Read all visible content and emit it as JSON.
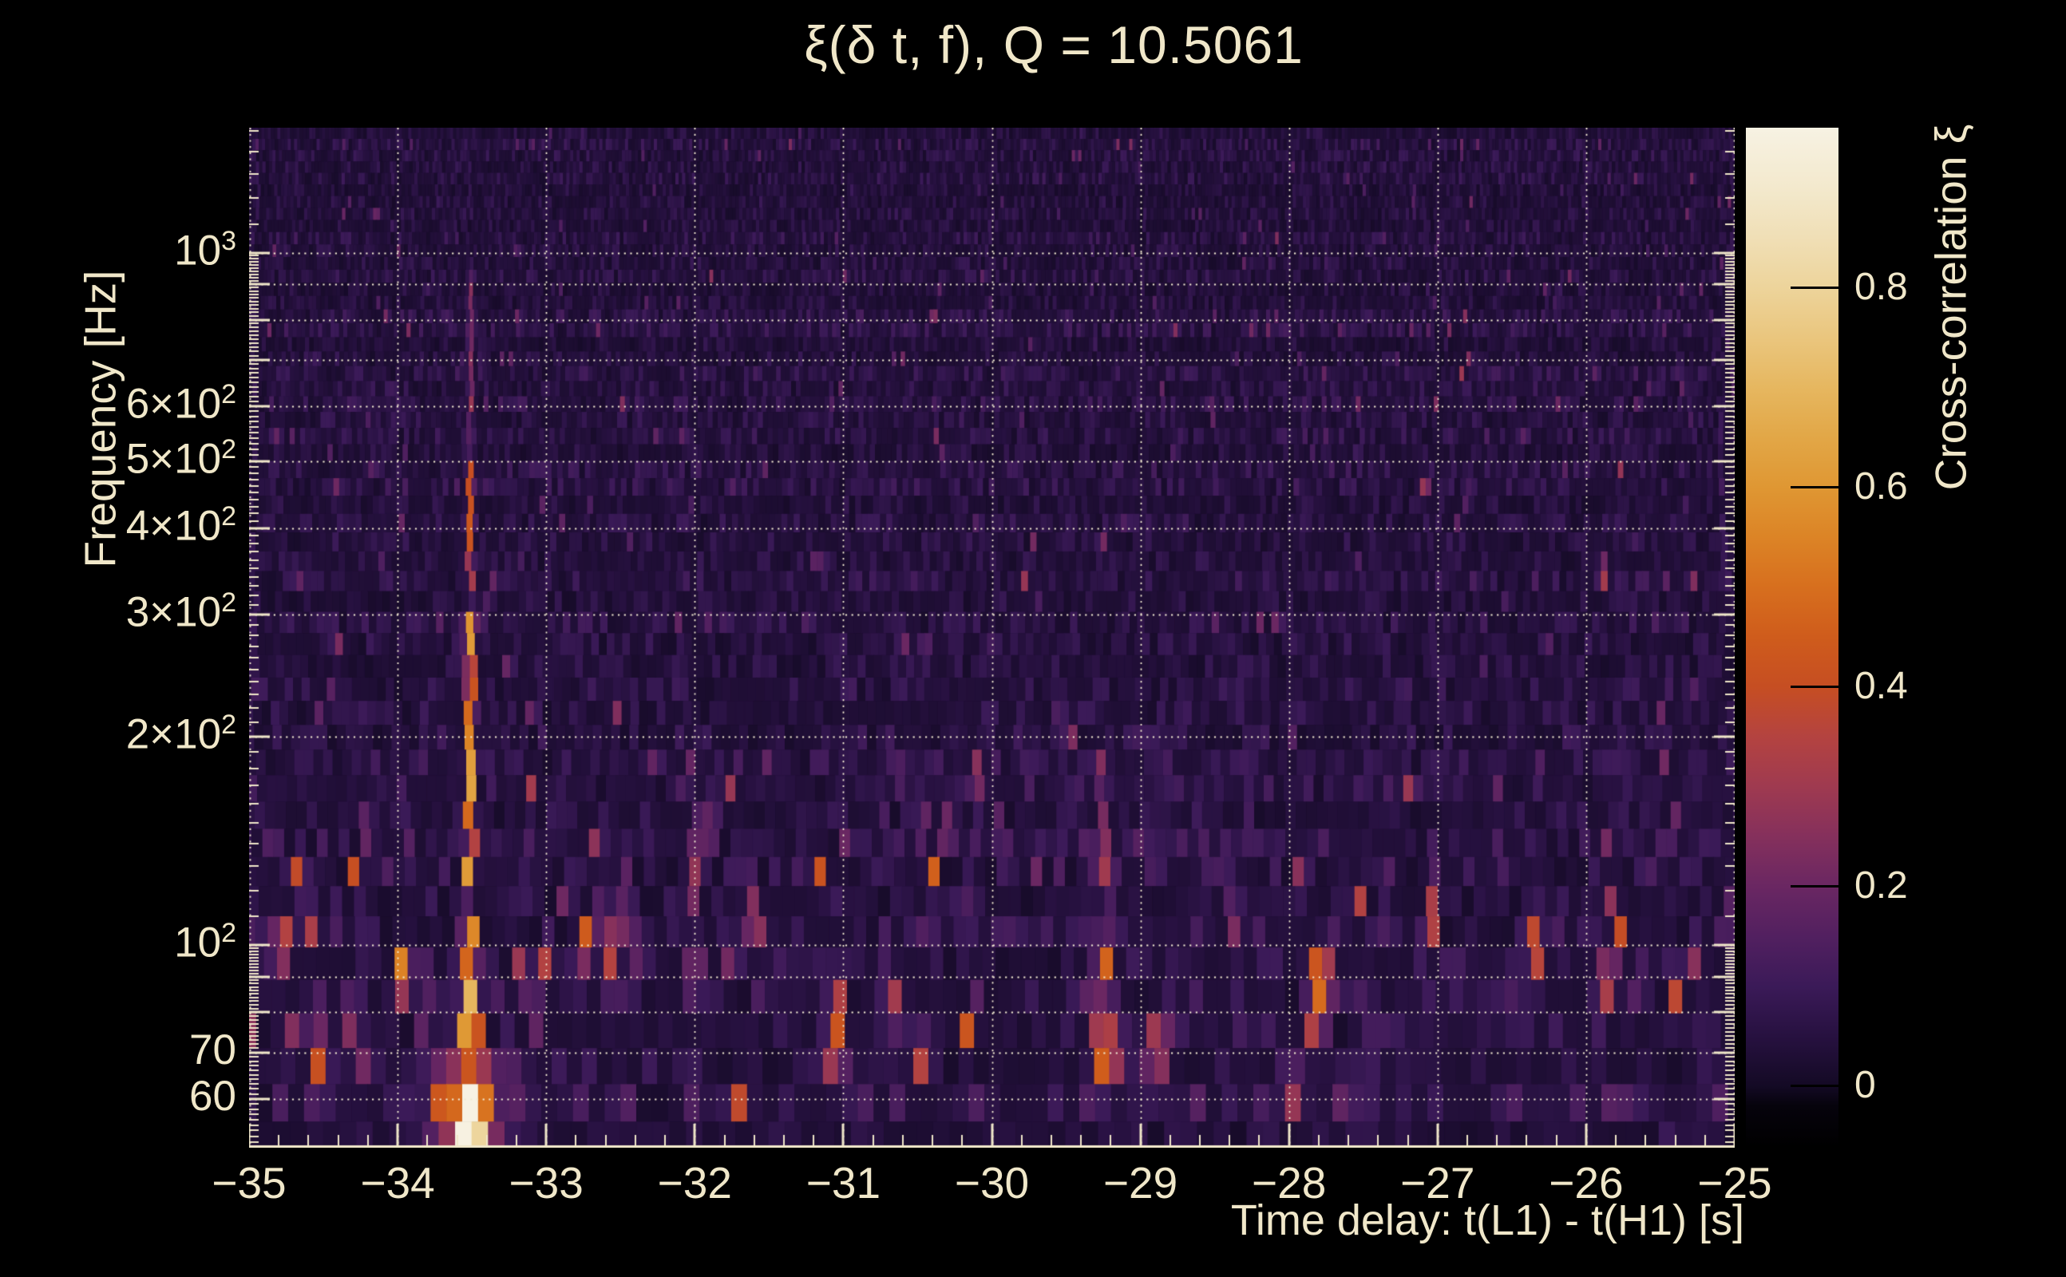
{
  "page": {
    "background": "#000000",
    "text_color": "#f0e7c9",
    "grid_color": "#f2ead1",
    "axis_color": "#f0e7c9"
  },
  "chart_data": {
    "type": "heatmap",
    "title": "ξ(δ t, f), Q = 10.5061",
    "q_value": 10.5061,
    "xlabel": "Time delay: t(L1) - t(H1) [s]",
    "ylabel": "Frequency [Hz]",
    "colorbar_label": "Cross-correlation ξ",
    "x": {
      "min": -35,
      "max": -25,
      "minor_step": 0.2,
      "grid": true,
      "major_ticks": [
        -35,
        -34,
        -33,
        -32,
        -31,
        -30,
        -29,
        -28,
        -27,
        -26,
        -25
      ],
      "tick_labels": [
        "−35",
        "−34",
        "−33",
        "−32",
        "−31",
        "−30",
        "−29",
        "−28",
        "−27",
        "−26",
        "−25"
      ]
    },
    "y": {
      "scale": "log",
      "min": 51,
      "max": 1515,
      "grid": true,
      "gridlines": [
        60,
        70,
        80,
        90,
        100,
        200,
        300,
        400,
        500,
        600,
        700,
        800,
        900,
        1000
      ],
      "tick_labels": [
        {
          "value": 1000,
          "mantissa": "10",
          "exponent": "3"
        },
        {
          "value": 600,
          "mantissa": "6×10",
          "exponent": "2"
        },
        {
          "value": 500,
          "mantissa": "5×10",
          "exponent": "2"
        },
        {
          "value": 400,
          "mantissa": "4×10",
          "exponent": "2"
        },
        {
          "value": 300,
          "mantissa": "3×10",
          "exponent": "2"
        },
        {
          "value": 200,
          "mantissa": "2×10",
          "exponent": "2"
        },
        {
          "value": 100,
          "mantissa": "10",
          "exponent": "2"
        },
        {
          "value": 70,
          "mantissa": "70",
          "exponent": ""
        },
        {
          "value": 60,
          "mantissa": "60",
          "exponent": ""
        }
      ]
    },
    "z": {
      "min": -0.062,
      "max": 0.96,
      "ticks": [
        0.8,
        0.6,
        0.4,
        0.2,
        0
      ],
      "tick_labels": [
        "0.8",
        "0.6",
        "0.4",
        "0.2",
        "0"
      ]
    },
    "palette": [
      {
        "v": -0.062,
        "c": "#000000"
      },
      {
        "v": -0.02,
        "c": "#06030c"
      },
      {
        "v": 0.0,
        "c": "#140a25"
      },
      {
        "v": 0.05,
        "c": "#271140"
      },
      {
        "v": 0.1,
        "c": "#3b1a58"
      },
      {
        "v": 0.15,
        "c": "#522060"
      },
      {
        "v": 0.2,
        "c": "#6a2762"
      },
      {
        "v": 0.25,
        "c": "#85305c"
      },
      {
        "v": 0.3,
        "c": "#9f3a50"
      },
      {
        "v": 0.35,
        "c": "#b44340"
      },
      {
        "v": 0.4,
        "c": "#c64e22"
      },
      {
        "v": 0.45,
        "c": "#cf5c1c"
      },
      {
        "v": 0.5,
        "c": "#d76f1e"
      },
      {
        "v": 0.55,
        "c": "#dc8426"
      },
      {
        "v": 0.6,
        "c": "#df9733"
      },
      {
        "v": 0.65,
        "c": "#e2a747"
      },
      {
        "v": 0.7,
        "c": "#e6b760"
      },
      {
        "v": 0.75,
        "c": "#eac67e"
      },
      {
        "v": 0.8,
        "c": "#edd49b"
      },
      {
        "v": 0.85,
        "c": "#f0dfb6"
      },
      {
        "v": 0.9,
        "c": "#f3e9cd"
      },
      {
        "v": 0.96,
        "c": "#f7f2e3"
      }
    ],
    "noise": {
      "seed": 1337,
      "dark_column_p": 0.18,
      "dark_column_factor": 0.45,
      "bands": [
        {
          "f_min": 200,
          "f_max": 1600,
          "base": 0.025,
          "var": 0.075,
          "spike_p": 0.035,
          "spike": 0.12
        },
        {
          "f_min": 130,
          "f_max": 200,
          "base": 0.03,
          "var": 0.09,
          "spike_p": 0.06,
          "spike": 0.16
        },
        {
          "f_min": 55,
          "f_max": 130,
          "base": 0.03,
          "var": 0.1,
          "spike_p": 0.1,
          "spike": 0.3
        },
        {
          "f_min": 40,
          "f_max": 55,
          "base": 0.02,
          "var": 0.05,
          "spike_p": 0.02,
          "spike": 0.1
        }
      ]
    },
    "features": [
      {
        "t": -33.51,
        "f_lo": 50,
        "f_hi": 66,
        "amp": 0.96,
        "sigma": 0.07
      },
      {
        "t": -33.51,
        "f_lo": 66,
        "f_hi": 80,
        "amp": 0.72,
        "sigma": 0.05
      },
      {
        "t": -33.51,
        "f_lo": 80,
        "f_hi": 115,
        "amp": 0.62,
        "sigma": 0.035
      },
      {
        "t": -33.51,
        "f_lo": 115,
        "f_hi": 310,
        "amp": 0.58,
        "sigma": 0.022
      },
      {
        "t": -33.51,
        "f_lo": 310,
        "f_hi": 520,
        "amp": 0.4,
        "sigma": 0.016
      },
      {
        "t": -33.51,
        "f_lo": 520,
        "f_hi": 950,
        "amp": 0.2,
        "sigma": 0.012
      },
      {
        "t": -33.51,
        "f_lo": 50,
        "f_hi": 72,
        "amp": 0.16,
        "sigma": 0.22
      },
      {
        "t": -34.78,
        "f_lo": 92,
        "f_hi": 112,
        "amp": 0.3,
        "sigma": 0.04
      },
      {
        "t": -34.52,
        "f_lo": 60,
        "f_hi": 78,
        "amp": 0.22,
        "sigma": 0.05
      },
      {
        "t": -34.3,
        "f_lo": 72,
        "f_hi": 88,
        "amp": 0.18,
        "sigma": 0.04
      },
      {
        "t": -34.2,
        "f_lo": 128,
        "f_hi": 165,
        "amp": 0.16,
        "sigma": 0.03
      },
      {
        "t": -33.95,
        "f_lo": 80,
        "f_hi": 100,
        "amp": 0.22,
        "sigma": 0.035
      },
      {
        "t": -32.98,
        "f_lo": 88,
        "f_hi": 102,
        "amp": 0.22,
        "sigma": 0.03
      },
      {
        "t": -32.6,
        "f_lo": 95,
        "f_hi": 118,
        "amp": 0.25,
        "sigma": 0.03
      },
      {
        "t": -32.0,
        "f_lo": 84,
        "f_hi": 104,
        "amp": 0.42,
        "sigma": 0.03
      },
      {
        "t": -32.0,
        "f_lo": 104,
        "f_hi": 160,
        "amp": 0.18,
        "sigma": 0.02
      },
      {
        "t": -31.9,
        "f_lo": 128,
        "f_hi": 170,
        "amp": 0.15,
        "sigma": 0.03
      },
      {
        "t": -31.6,
        "f_lo": 100,
        "f_hi": 118,
        "amp": 0.3,
        "sigma": 0.03
      },
      {
        "t": -31.05,
        "f_lo": 60,
        "f_hi": 92,
        "amp": 0.3,
        "sigma": 0.04
      },
      {
        "t": -30.65,
        "f_lo": 74,
        "f_hi": 90,
        "amp": 0.27,
        "sigma": 0.035
      },
      {
        "t": -30.48,
        "f_lo": 60,
        "f_hi": 76,
        "amp": 0.26,
        "sigma": 0.035
      },
      {
        "t": -30.3,
        "f_lo": 130,
        "f_hi": 165,
        "amp": 0.17,
        "sigma": 0.03
      },
      {
        "t": -29.25,
        "f_lo": 86,
        "f_hi": 106,
        "amp": 0.55,
        "sigma": 0.035
      },
      {
        "t": -29.25,
        "f_lo": 60,
        "f_hi": 86,
        "amp": 0.42,
        "sigma": 0.05
      },
      {
        "t": -29.25,
        "f_lo": 106,
        "f_hi": 200,
        "amp": 0.18,
        "sigma": 0.02
      },
      {
        "t": -28.88,
        "f_lo": 64,
        "f_hi": 80,
        "amp": 0.28,
        "sigma": 0.04
      },
      {
        "t": -28.6,
        "f_lo": 130,
        "f_hi": 160,
        "amp": 0.14,
        "sigma": 0.03
      },
      {
        "t": -28.35,
        "f_lo": 95,
        "f_hi": 115,
        "amp": 0.24,
        "sigma": 0.03
      },
      {
        "t": -27.97,
        "f_lo": 54,
        "f_hi": 68,
        "amp": 0.25,
        "sigma": 0.05
      },
      {
        "t": -27.82,
        "f_lo": 68,
        "f_hi": 104,
        "amp": 0.38,
        "sigma": 0.04
      },
      {
        "t": -26.9,
        "f_lo": 84,
        "f_hi": 100,
        "amp": 0.22,
        "sigma": 0.03
      },
      {
        "t": -26.35,
        "f_lo": 86,
        "f_hi": 110,
        "amp": 0.3,
        "sigma": 0.035
      },
      {
        "t": -25.85,
        "f_lo": 78,
        "f_hi": 100,
        "amp": 0.3,
        "sigma": 0.035
      },
      {
        "t": -25.3,
        "f_lo": 85,
        "f_hi": 102,
        "amp": 0.22,
        "sigma": 0.03
      }
    ]
  }
}
